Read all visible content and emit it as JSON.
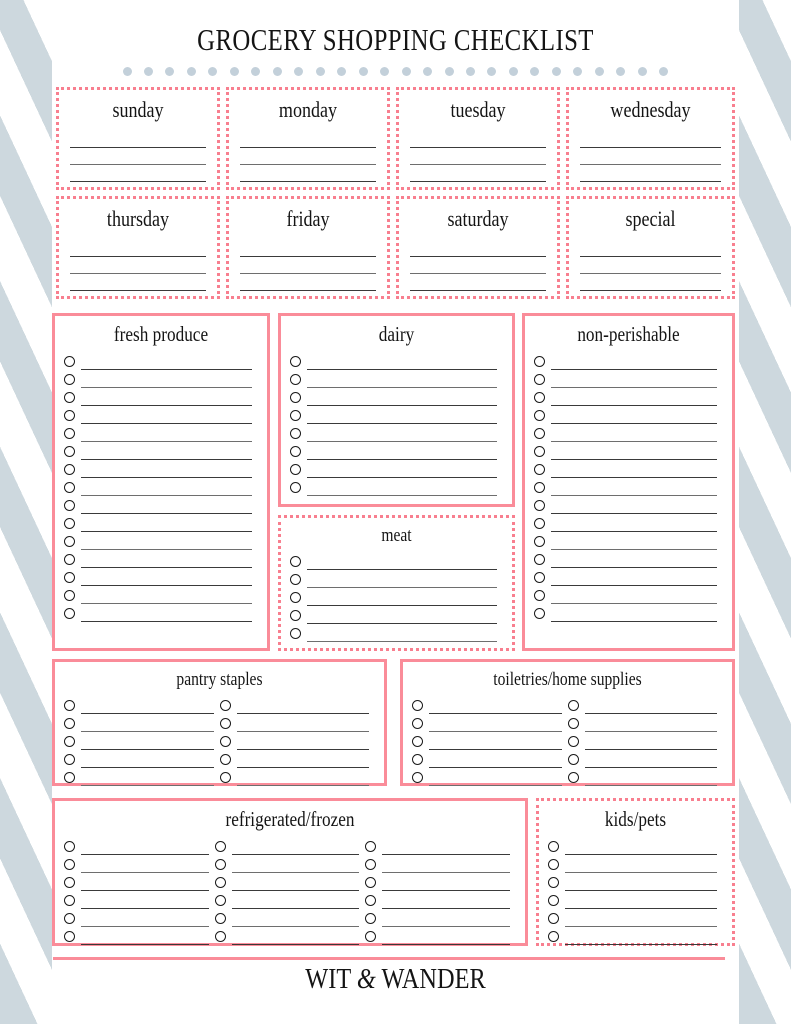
{
  "header": {
    "title": "GROCERY SHOPPING CHECKLIST",
    "dot_count": 26,
    "dot_color": "#c3d0da"
  },
  "colors": {
    "accent_pink": "#fa8c99",
    "stripe_blue": "#cdd8de",
    "rule_dark": "#3a3a3a",
    "rule_light": "#6e6e6e",
    "text": "#141414"
  },
  "day_boxes": [
    {
      "label": "sunday",
      "lines": 3,
      "border": "dotted"
    },
    {
      "label": "monday",
      "lines": 3,
      "border": "dotted"
    },
    {
      "label": "tuesday",
      "lines": 3,
      "border": "dotted"
    },
    {
      "label": "wednesday",
      "lines": 3,
      "border": "dotted"
    },
    {
      "label": "thursday",
      "lines": 3,
      "border": "dotted"
    },
    {
      "label": "friday",
      "lines": 3,
      "border": "dotted"
    },
    {
      "label": "saturday",
      "lines": 3,
      "border": "dotted"
    },
    {
      "label": "special",
      "lines": 3,
      "border": "dotted"
    }
  ],
  "categories": [
    {
      "label": "fresh produce",
      "columns": 1,
      "rows": 15,
      "border": "solid"
    },
    {
      "label": "dairy",
      "columns": 1,
      "rows": 8,
      "border": "solid"
    },
    {
      "label": "meat",
      "columns": 1,
      "rows": 5,
      "border": "dotted"
    },
    {
      "label": "non-perishable",
      "columns": 1,
      "rows": 15,
      "border": "solid"
    },
    {
      "label": "pantry staples",
      "columns": 2,
      "rows": 5,
      "border": "solid"
    },
    {
      "label": "toiletries/home supplies",
      "columns": 2,
      "rows": 5,
      "border": "solid"
    },
    {
      "label": "refrigerated/frozen",
      "columns": 3,
      "rows": 6,
      "border": "solid"
    },
    {
      "label": "kids/pets",
      "columns": 1,
      "rows": 6,
      "border": "dotted"
    }
  ],
  "footer": {
    "brand_pre": "WIT ",
    "brand_amp": "&",
    "brand_post": " WANDER"
  }
}
